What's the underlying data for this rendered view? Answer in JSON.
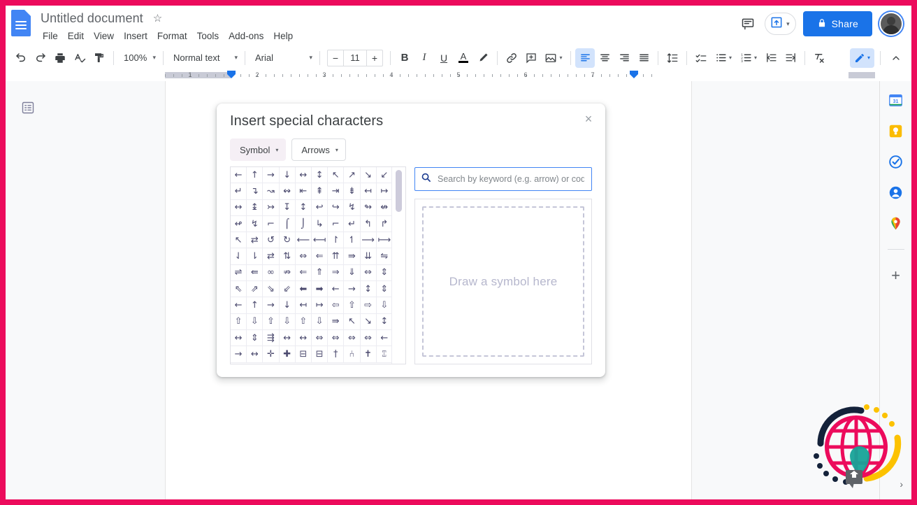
{
  "app": {
    "logo_icon": "google-docs-logo",
    "doc_title": "Untitled document",
    "star_icon": "☆",
    "menus": [
      "File",
      "Edit",
      "View",
      "Insert",
      "Format",
      "Tools",
      "Add-ons",
      "Help"
    ]
  },
  "header_right": {
    "comment_icon": "comment-history-icon",
    "present_icon": "present-icon",
    "present_caret": "▾",
    "share_label": "Share",
    "share_lock_icon": "lock-icon",
    "share_bg": "#1a73e8",
    "avatar_icon": "user-avatar"
  },
  "toolbar": {
    "undo_icon": "undo-icon",
    "redo_icon": "redo-icon",
    "print_icon": "print-icon",
    "spellcheck_icon": "spellcheck-icon",
    "paint_format_icon": "paint-format-icon",
    "zoom_value": "100%",
    "style_value": "Normal text",
    "font_value": "Arial",
    "font_size_minus": "−",
    "font_size_value": "11",
    "font_size_plus": "+",
    "bold_label": "B",
    "italic_label": "I",
    "underline_label": "U",
    "text_color_label": "A",
    "highlight_icon": "highlight-pen-icon",
    "link_icon": "insert-link-icon",
    "comment_icon": "add-comment-icon",
    "image_icon": "insert-image-icon",
    "align_left_icon": "align-left-icon",
    "align_center_icon": "align-center-icon",
    "align_right_icon": "align-right-icon",
    "align_justify_icon": "align-justify-icon",
    "line_spacing_icon": "line-spacing-icon",
    "checklist_icon": "checklist-icon",
    "bulleted_list_icon": "bulleted-list-icon",
    "numbered_list_icon": "numbered-list-icon",
    "decrease_indent_icon": "decrease-indent-icon",
    "increase_indent_icon": "increase-indent-icon",
    "clear_format_icon": "clear-formatting-icon",
    "edit_mode_icon": "pencil-icon",
    "edit_mode_caret": "▾",
    "collapse_icon": "chevron-up-icon"
  },
  "ruler": {
    "numbers": [
      "1",
      "1",
      "2",
      "3",
      "4",
      "5",
      "6",
      "7"
    ],
    "indent_marker": "indent-marker"
  },
  "document": {
    "outline_icon": "document-outline-icon"
  },
  "dialog": {
    "title": "Insert special characters",
    "close_icon": "×",
    "category_primary": "Symbol",
    "category_secondary": "Arrows",
    "caret": "▾",
    "search_icon": "search-icon",
    "search_value": "",
    "search_placeholder": "Search by keyword (e.g. arrow) or codepoint",
    "draw_hint": "Draw a symbol here",
    "symbols": [
      "←",
      "↑",
      "→",
      "↓",
      "↔",
      "↕",
      "↖",
      "↗",
      "↘",
      "↙",
      "↵",
      "↴",
      "↝",
      "↭",
      "⇤",
      "⇞",
      "⇥",
      "⇟",
      "↤",
      "↦",
      "↔",
      "↨",
      "↣",
      "↧",
      "↕",
      "↩",
      "↪",
      "↯",
      "↬",
      "↮",
      "↫",
      "↯",
      "⌐",
      "⌠",
      "⌡",
      "↳",
      "⌐",
      "↵",
      "↰",
      "↱",
      "↖",
      "⇄",
      "↺",
      "↻",
      "⟵",
      "⟻",
      "↾",
      "↿",
      "⟶",
      "⟼",
      "⇃",
      "⇂",
      "⇄",
      "⇅",
      "⇔",
      "⇐",
      "⇈",
      "⇛",
      "⇊",
      "⇋",
      "⇌",
      "⇚",
      "∞",
      "⇏",
      "⇐",
      "⇑",
      "⇒",
      "⇓",
      "⇔",
      "⇕",
      "⇖",
      "⇗",
      "⇘",
      "⇙",
      "⬅",
      "➡",
      "←",
      "→",
      "↕",
      "⇕",
      "←",
      "↑",
      "→",
      "↓",
      "↤",
      "↦",
      "⇦",
      "⇧",
      "⇨",
      "⇩",
      "⇧",
      "⇩",
      "⇧",
      "⇩",
      "⇧",
      "⇩",
      "⇛",
      "↖",
      "↘",
      "↕",
      "↔",
      "⇕",
      "⇶",
      "↔",
      "↔",
      "⇔",
      "⇔",
      "⇔",
      "⇔",
      "←",
      "→",
      "↔",
      "✛",
      "✚",
      "⊟",
      "⊟",
      "†",
      "⑃",
      "✝",
      "⑄"
    ]
  },
  "rail": {
    "items": [
      {
        "name": "google-calendar-icon",
        "glyph": "31"
      },
      {
        "name": "google-keep-icon",
        "glyph": "💡"
      },
      {
        "name": "google-tasks-icon",
        "glyph": "✓"
      },
      {
        "name": "google-contacts-icon",
        "glyph": "👤"
      },
      {
        "name": "google-maps-icon",
        "glyph": "📍"
      }
    ],
    "plus_label": "+",
    "expand_icon": "›"
  },
  "colors": {
    "frame_border": "#ec0b5c",
    "accent_blue": "#1a73e8",
    "toolbar_text": "#3c4043",
    "symbol_color": "#4b4a6e"
  }
}
